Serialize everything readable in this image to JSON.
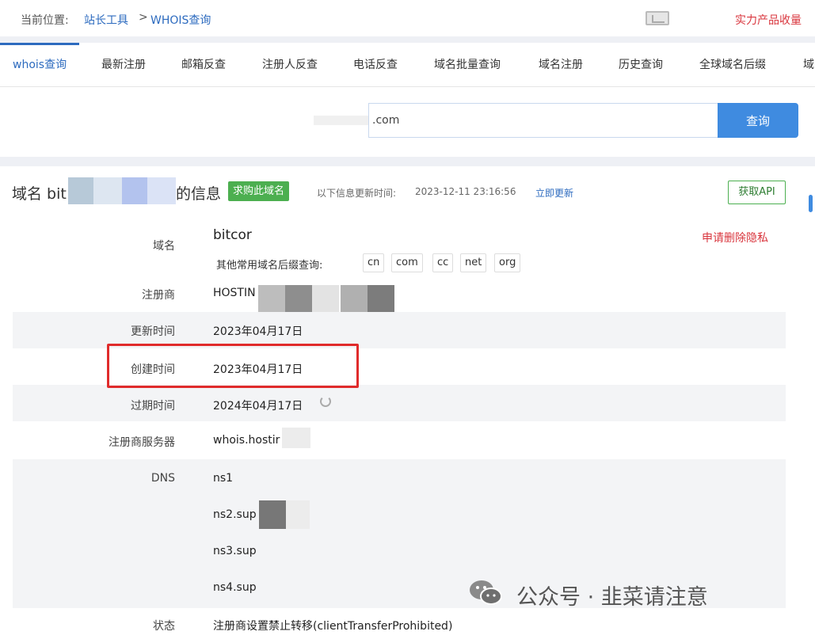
{
  "breadcrumb": {
    "label": "当前位置:",
    "link1": "站长工具",
    "separator": ">",
    "link2": "WHOIS查询",
    "favorite": "实力产品收量"
  },
  "tabs": [
    {
      "label": "whois查询",
      "active": true
    },
    {
      "label": "最新注册"
    },
    {
      "label": "邮箱反查"
    },
    {
      "label": "注册人反查"
    },
    {
      "label": "电话反查"
    },
    {
      "label": "域名批量查询"
    },
    {
      "label": "域名注册"
    },
    {
      "label": "历史查询"
    },
    {
      "label": "全球域名后缀"
    },
    {
      "label": "域"
    }
  ],
  "search": {
    "value": ".com",
    "button": "查询"
  },
  "result": {
    "title_prefix": "域名 bit",
    "title_suffix": "的信息",
    "buy_badge": "求购此域名",
    "updated_label": "以下信息更新时间:",
    "updated_time": "2023-12-11 23:16:56",
    "refresh_link": "立即更新",
    "api_button": "获取API",
    "privacy_link": "申请删除隐私",
    "suffix_caption": "其他常用域名后缀查询:",
    "suffixes": [
      "cn",
      "com",
      "cc",
      "net",
      "org"
    ],
    "rows": {
      "domain": {
        "label": "域名",
        "value": "bitcor"
      },
      "registrar": {
        "label": "注册商",
        "value": "HOSTIN"
      },
      "updated": {
        "label": "更新时间",
        "value": "2023年04月17日"
      },
      "created": {
        "label": "创建时间",
        "value": "2023年04月17日"
      },
      "expires": {
        "label": "过期时间",
        "value": "2024年04月17日"
      },
      "whois_server": {
        "label": "注册商服务器",
        "value": "whois.hostir"
      },
      "dns": {
        "label": "DNS",
        "values": [
          "ns1",
          "ns2.sup",
          "ns3.sup",
          "ns4.sup"
        ]
      },
      "status": {
        "label": "状态",
        "value": "注册商设置禁止转移(clientTransferProhibited)"
      }
    }
  },
  "watermark": {
    "text": "公众号 · 韭菜请注意"
  },
  "colors": {
    "link_blue": "#2d6bbf",
    "search_button": "#3f8be0",
    "buy_green": "#4caf50",
    "alert_red": "#d9363e",
    "highlight_red": "#e02b2b"
  }
}
